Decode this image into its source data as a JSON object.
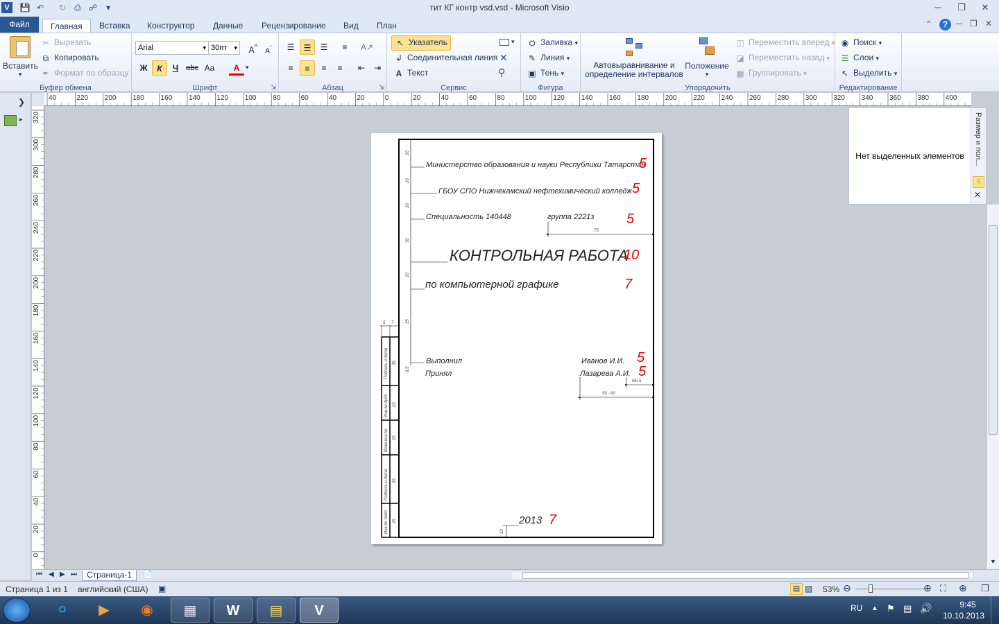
{
  "window": {
    "title": "тит КГ контр vsd.vsd  -  Microsoft Visio"
  },
  "tabs": [
    "Файл",
    "Главная",
    "Вставка",
    "Конструктор",
    "Данные",
    "Рецензирование",
    "Вид",
    "План"
  ],
  "ribbon": {
    "clipboard": {
      "paste": "Вставить",
      "cut": "Вырезать",
      "copy": "Копировать",
      "format": "Формат по образцу",
      "label": "Буфер обмена"
    },
    "font": {
      "name": "Arial",
      "size": "30пт",
      "bold": "Ж",
      "italic": "К",
      "underline": "Ч",
      "strike": "abc",
      "case": "Aa",
      "color": "A",
      "label": "Шрифт"
    },
    "paragraph": {
      "label": "Абзац"
    },
    "tools": {
      "pointer": "Указатель",
      "connector": "Соединительная линия",
      "text": "Текст",
      "label": "Сервис"
    },
    "shape": {
      "fill": "Заливка",
      "line": "Линия",
      "shadow": "Тень",
      "label": "Фигура"
    },
    "arrange": {
      "autoalign": "Автовыравнивание и определение интервалов",
      "position": "Положение",
      "forward": "Переместить вперед",
      "backward": "Переместить назад",
      "group": "Группировать",
      "label": "Упорядочить"
    },
    "editing": {
      "find": "Поиск",
      "layers": "Слои",
      "select": "Выделить",
      "label": "Редактирование"
    }
  },
  "hruler": [
    "40",
    "220",
    "200",
    "180",
    "160",
    "140",
    "120",
    "100",
    "80",
    "60",
    "40",
    "20",
    "0",
    "20",
    "40",
    "60",
    "80",
    "100",
    "120",
    "140",
    "160",
    "180",
    "200",
    "220",
    "240",
    "260",
    "280",
    "300",
    "320",
    "340",
    "360",
    "380",
    "400"
  ],
  "vruler": [
    "320",
    "300",
    "280",
    "260",
    "240",
    "220",
    "200",
    "180",
    "160",
    "140",
    "120",
    "100",
    "80",
    "60",
    "40",
    "20",
    "0"
  ],
  "sizepanel": {
    "message": "Нет выделенных элементов",
    "title": "Размер и пол..."
  },
  "drawing": {
    "ministry": "Министерство образования и науки Республики Татарстан",
    "college": "ГБОУ СПО Нижнекамский нефтехимический колледж",
    "specialty": "Специальность 140448",
    "group": "группа 2221з",
    "title": "КОНТРОЛЬНАЯ РАБОТА",
    "subject": "по компьютерной графике",
    "done_by": "Выполнил",
    "accepted": "Принял",
    "student": "Иванов И.И.",
    "teacher": "Лазарева А.И.",
    "year": "2013",
    "scores": [
      "5",
      "5",
      "5",
      "10",
      "7",
      "5",
      "5",
      "7"
    ],
    "dims": {
      "d20a": "20",
      "d20b": "20",
      "d20c": "20",
      "d30": "30",
      "d20d": "20",
      "d35": "35",
      "d85": "8,5",
      "d75": "75",
      "d5060": "50 - 60",
      "dmin5": "Мн 5",
      "d5": "5",
      "d7": "7",
      "d10": "10"
    },
    "stamps": [
      "Подпись и дата",
      "Инв.№ дубл",
      "Взам.инв.№",
      "Подпись и дата",
      "Инв.№ подл"
    ],
    "stamp_dims": [
      "35",
      "25",
      "25",
      "35",
      "25"
    ]
  },
  "page_tabs": {
    "current": "Страница-1"
  },
  "status": {
    "page": "Страница 1 из 1",
    "language": "английский (США)",
    "zoom": "53%"
  },
  "taskbar": {
    "lang": "RU",
    "time": "9:45",
    "date": "10.10.2013"
  }
}
